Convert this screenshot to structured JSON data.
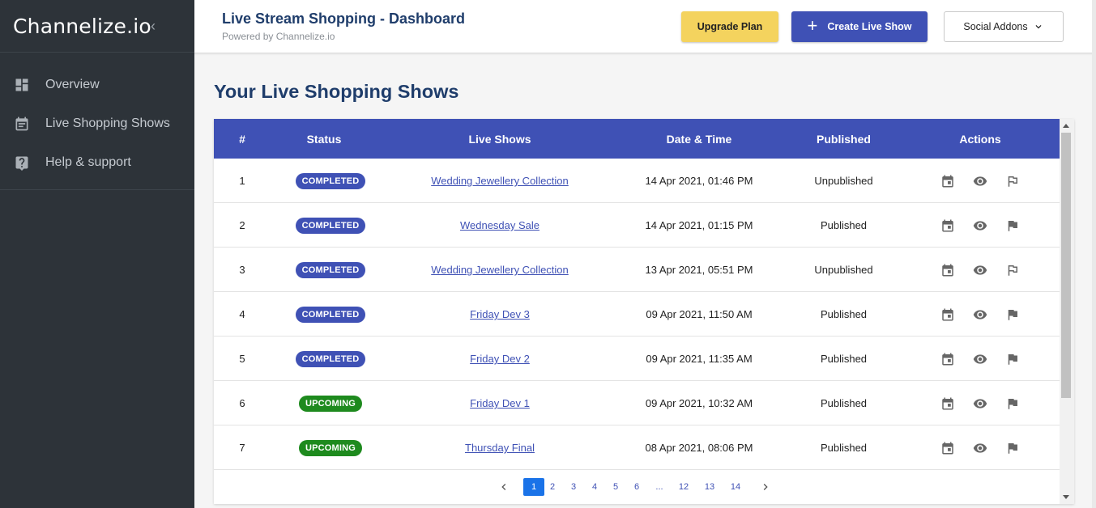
{
  "brand": {
    "name": "Channelize.io",
    "collapse_icon": "‹"
  },
  "sidebar": {
    "items": [
      {
        "label": "Overview",
        "icon": "dashboard-icon"
      },
      {
        "label": "Live Shopping Shows",
        "icon": "calendar-icon"
      },
      {
        "label": "Help & support",
        "icon": "help-icon"
      }
    ]
  },
  "header": {
    "title": "Live Stream Shopping - Dashboard",
    "subtitle": "Powered by Channelize.io",
    "upgrade_label": "Upgrade Plan",
    "create_label": "Create Live Show",
    "social_label": "Social Addons"
  },
  "main": {
    "heading": "Your Live Shopping Shows",
    "table": {
      "columns": [
        "#",
        "Status",
        "Live Shows",
        "Date & Time",
        "Published",
        "Actions"
      ],
      "rows": [
        {
          "num": "1",
          "status": "COMPLETED",
          "status_type": "completed",
          "show": "Wedding Jewellery Collection",
          "date": "14 Apr 2021, 01:46 PM",
          "published": "Unpublished",
          "flag": "outline"
        },
        {
          "num": "2",
          "status": "COMPLETED",
          "status_type": "completed",
          "show": "Wednesday Sale",
          "date": "14 Apr 2021, 01:15 PM",
          "published": "Published",
          "flag": "filled"
        },
        {
          "num": "3",
          "status": "COMPLETED",
          "status_type": "completed",
          "show": "Wedding Jewellery Collection",
          "date": "13 Apr 2021, 05:51 PM",
          "published": "Unpublished",
          "flag": "outline"
        },
        {
          "num": "4",
          "status": "COMPLETED",
          "status_type": "completed",
          "show": "Friday Dev 3",
          "date": "09 Apr 2021, 11:50 AM",
          "published": "Published",
          "flag": "filled"
        },
        {
          "num": "5",
          "status": "COMPLETED",
          "status_type": "completed",
          "show": "Friday Dev 2",
          "date": "09 Apr 2021, 11:35 AM",
          "published": "Published",
          "flag": "filled"
        },
        {
          "num": "6",
          "status": "UPCOMING",
          "status_type": "upcoming",
          "show": "Friday Dev 1",
          "date": "09 Apr 2021, 10:32 AM",
          "published": "Published",
          "flag": "filled"
        },
        {
          "num": "7",
          "status": "UPCOMING",
          "status_type": "upcoming",
          "show": "Thursday Final",
          "date": "08 Apr 2021, 08:06 PM",
          "published": "Published",
          "flag": "filled"
        }
      ]
    },
    "pagination": {
      "pages": [
        "1",
        "2",
        "3",
        "4",
        "5",
        "6",
        "...",
        "12",
        "13",
        "14"
      ],
      "current": "1"
    }
  },
  "colors": {
    "primary": "#3f51b5",
    "sidebar_bg": "#2d3339",
    "upgrade": "#f4d35e",
    "upcoming": "#1e8a1e",
    "heading": "#1f3d6b"
  }
}
